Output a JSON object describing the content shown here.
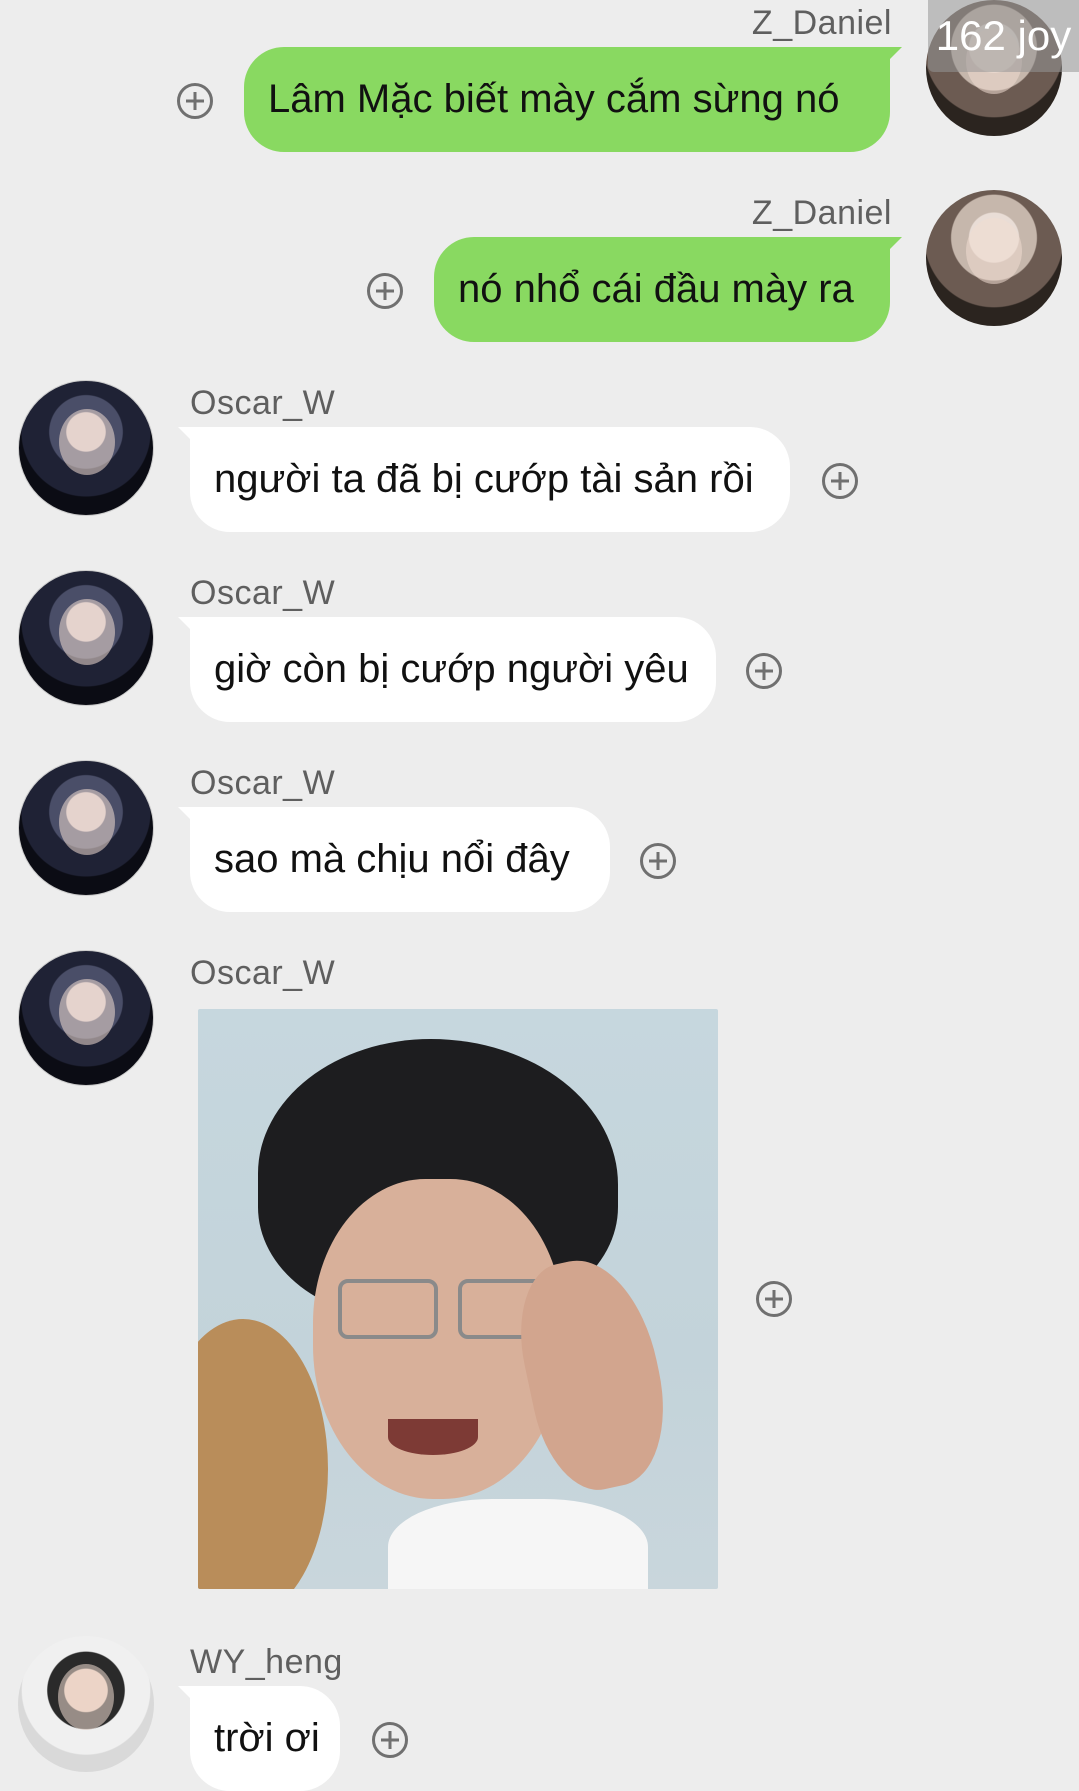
{
  "watermark": "162 joy",
  "messages": [
    {
      "sender": "Z_Daniel",
      "text": "Lâm Mặc biết mày cắm sừng nó"
    },
    {
      "sender": "Z_Daniel",
      "text": "nó nhổ cái đầu mày ra"
    },
    {
      "sender": "Oscar_W",
      "text": "người ta đã bị cướp tài sản rồi"
    },
    {
      "sender": "Oscar_W",
      "text": "giờ còn bị cướp người yêu"
    },
    {
      "sender": "Oscar_W",
      "text": "sao mà chịu nổi đây"
    },
    {
      "sender": "Oscar_W",
      "image": "crying-meme-photo"
    },
    {
      "sender": "WY_heng",
      "text": "trời ơi"
    }
  ],
  "icons": {
    "add": "plus-circle-icon"
  },
  "colors": {
    "outgoing_bubble": "#89d961",
    "incoming_bubble": "#ffffff",
    "background": "#ededed"
  }
}
